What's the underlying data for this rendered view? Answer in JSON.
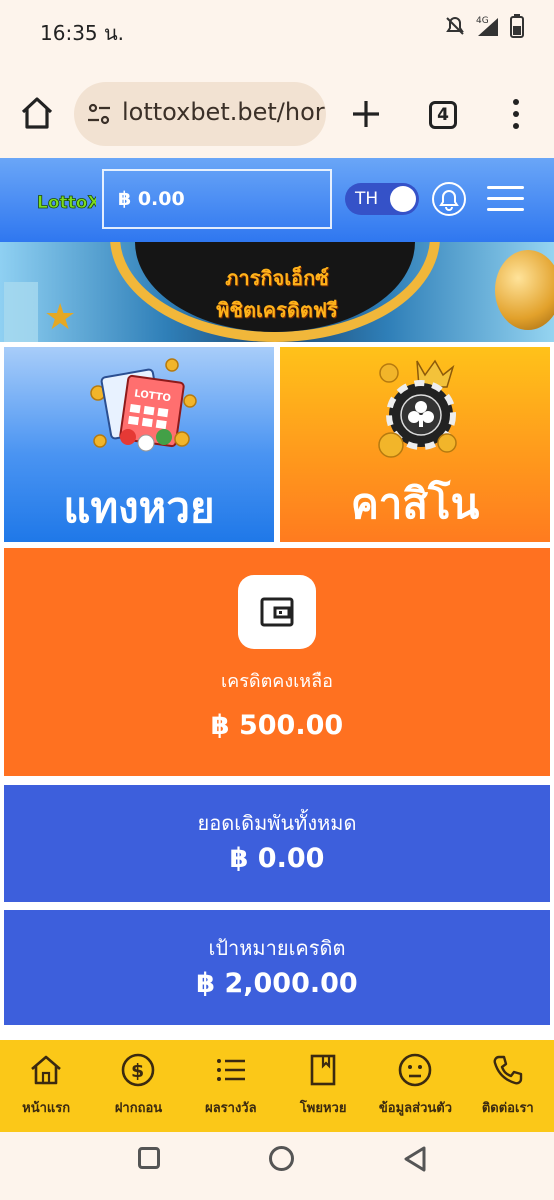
{
  "status_bar": {
    "time": "16:35 น.",
    "network": "4G"
  },
  "browser": {
    "url": "lottoxbet.bet/hor",
    "tab_count": "4"
  },
  "header": {
    "logo_text": "LottoX",
    "balance": "฿ 0.00",
    "language": "TH"
  },
  "banner": {
    "line1": "ภารกิจเอ็กซ์",
    "line2": "พิชิตเครดิตฟรี"
  },
  "tiles": {
    "lotto_label": "แทงหวย",
    "casino_label": "คาสิโน",
    "lotto_ticket_text": "LOTTO"
  },
  "credit_card": {
    "label": "เครดิตคงเหลือ",
    "value": "฿ 500.00"
  },
  "bets_card": {
    "label": "ยอดเดิมพันทั้งหมด",
    "value": "฿ 0.00"
  },
  "target_card": {
    "label": "เป้าหมายเครดิต",
    "value": "฿ 2,000.00"
  },
  "bottom_nav": [
    {
      "label": "หน้าแรก",
      "icon": "home-icon"
    },
    {
      "label": "ฝากถอน",
      "icon": "dollar-icon"
    },
    {
      "label": "ผลรางวัล",
      "icon": "list-icon"
    },
    {
      "label": "โพยหวย",
      "icon": "book-icon"
    },
    {
      "label": "ข้อมูลส่วนตัว",
      "icon": "face-icon"
    },
    {
      "label": "ติดต่อเรา",
      "icon": "phone-icon"
    }
  ],
  "colors": {
    "header_blue": "#2f77f0",
    "orange": "#ff7120",
    "card_blue": "#3d5fdc",
    "nav_yellow": "#fbc818"
  }
}
